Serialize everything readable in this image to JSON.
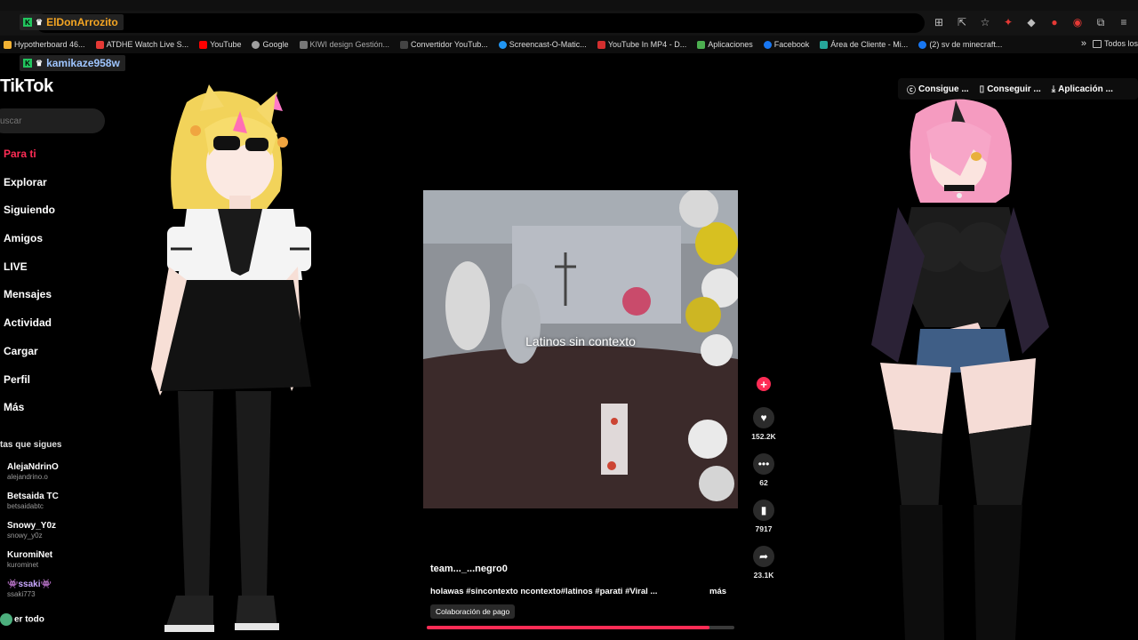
{
  "browser": {
    "toolbar_icons": [
      "translate-icon",
      "install-icon",
      "star-icon",
      "extension-red-icon",
      "extension-icon",
      "recording-icon",
      "extension-circle-icon",
      "puzzle-icon",
      "menu-icon"
    ],
    "bookmarks": [
      {
        "label": "Hypotherboard 46...",
        "color": "#f2b233"
      },
      {
        "label": "ATDHE Watch Live S...",
        "color": "#e53935"
      },
      {
        "label": "YouTube",
        "color": "#ff0000"
      },
      {
        "label": "Google",
        "color": "#9e9e9e"
      },
      {
        "label": "KIWI design Gestión...",
        "color": "#777777"
      },
      {
        "label": "Convertidor YouTub...",
        "color": "#444444"
      },
      {
        "label": "Screencast-O-Matic...",
        "color": "#2196f3"
      },
      {
        "label": "YouTube In MP4 - D...",
        "color": "#d32f2f"
      },
      {
        "label": "Aplicaciones",
        "color": "#4caf50"
      },
      {
        "label": "Facebook",
        "color": "#1877f2"
      },
      {
        "label": "Área de Cliente - Mi...",
        "color": "#26a69a"
      },
      {
        "label": "(2) sv de minecraft...",
        "color": "#1877f2"
      }
    ],
    "all_bookmarks": "Todos los"
  },
  "chat_overlay": [
    {
      "name": "ElDonArrozito",
      "color": "#f5a623"
    },
    {
      "name": "kamikaze958w",
      "color": "#9ec5ff"
    }
  ],
  "tiktok": {
    "logo": "TikTok",
    "search_placeholder": "uscar",
    "nav": [
      "Para ti",
      "Explorar",
      "Siguiendo",
      "Amigos",
      "LIVE",
      "Mensajes",
      "Actividad",
      "Cargar",
      "Perfil",
      "Más"
    ],
    "following_title": "tas que sigues",
    "following": [
      {
        "name": "AlejaNdrinO",
        "handle": "alejandrino.o"
      },
      {
        "name": "Betsaida TC",
        "handle": "betsaidabtc"
      },
      {
        "name": "Snowy_Y0z",
        "handle": "snowy_y0z"
      },
      {
        "name": "KuromiNet",
        "handle": "kurominet"
      },
      {
        "name": "👾ssaki👾",
        "handle": "ssaki773"
      }
    ],
    "see_all": "er todo",
    "video": {
      "caption": "Latinos sin contexto",
      "author": "team..._...negro0",
      "description": "holawas #sincontexto ncontexto#latinos #parati #Viral ...",
      "more": "más",
      "chip": "Colaboración de pago",
      "likes": "152.2K",
      "comments": "62",
      "saves": "7917",
      "shares": "23.1K",
      "progress": 0.92
    },
    "header_buttons": [
      "Consigue ...",
      "Conseguir ...",
      "Aplicación ..."
    ]
  }
}
